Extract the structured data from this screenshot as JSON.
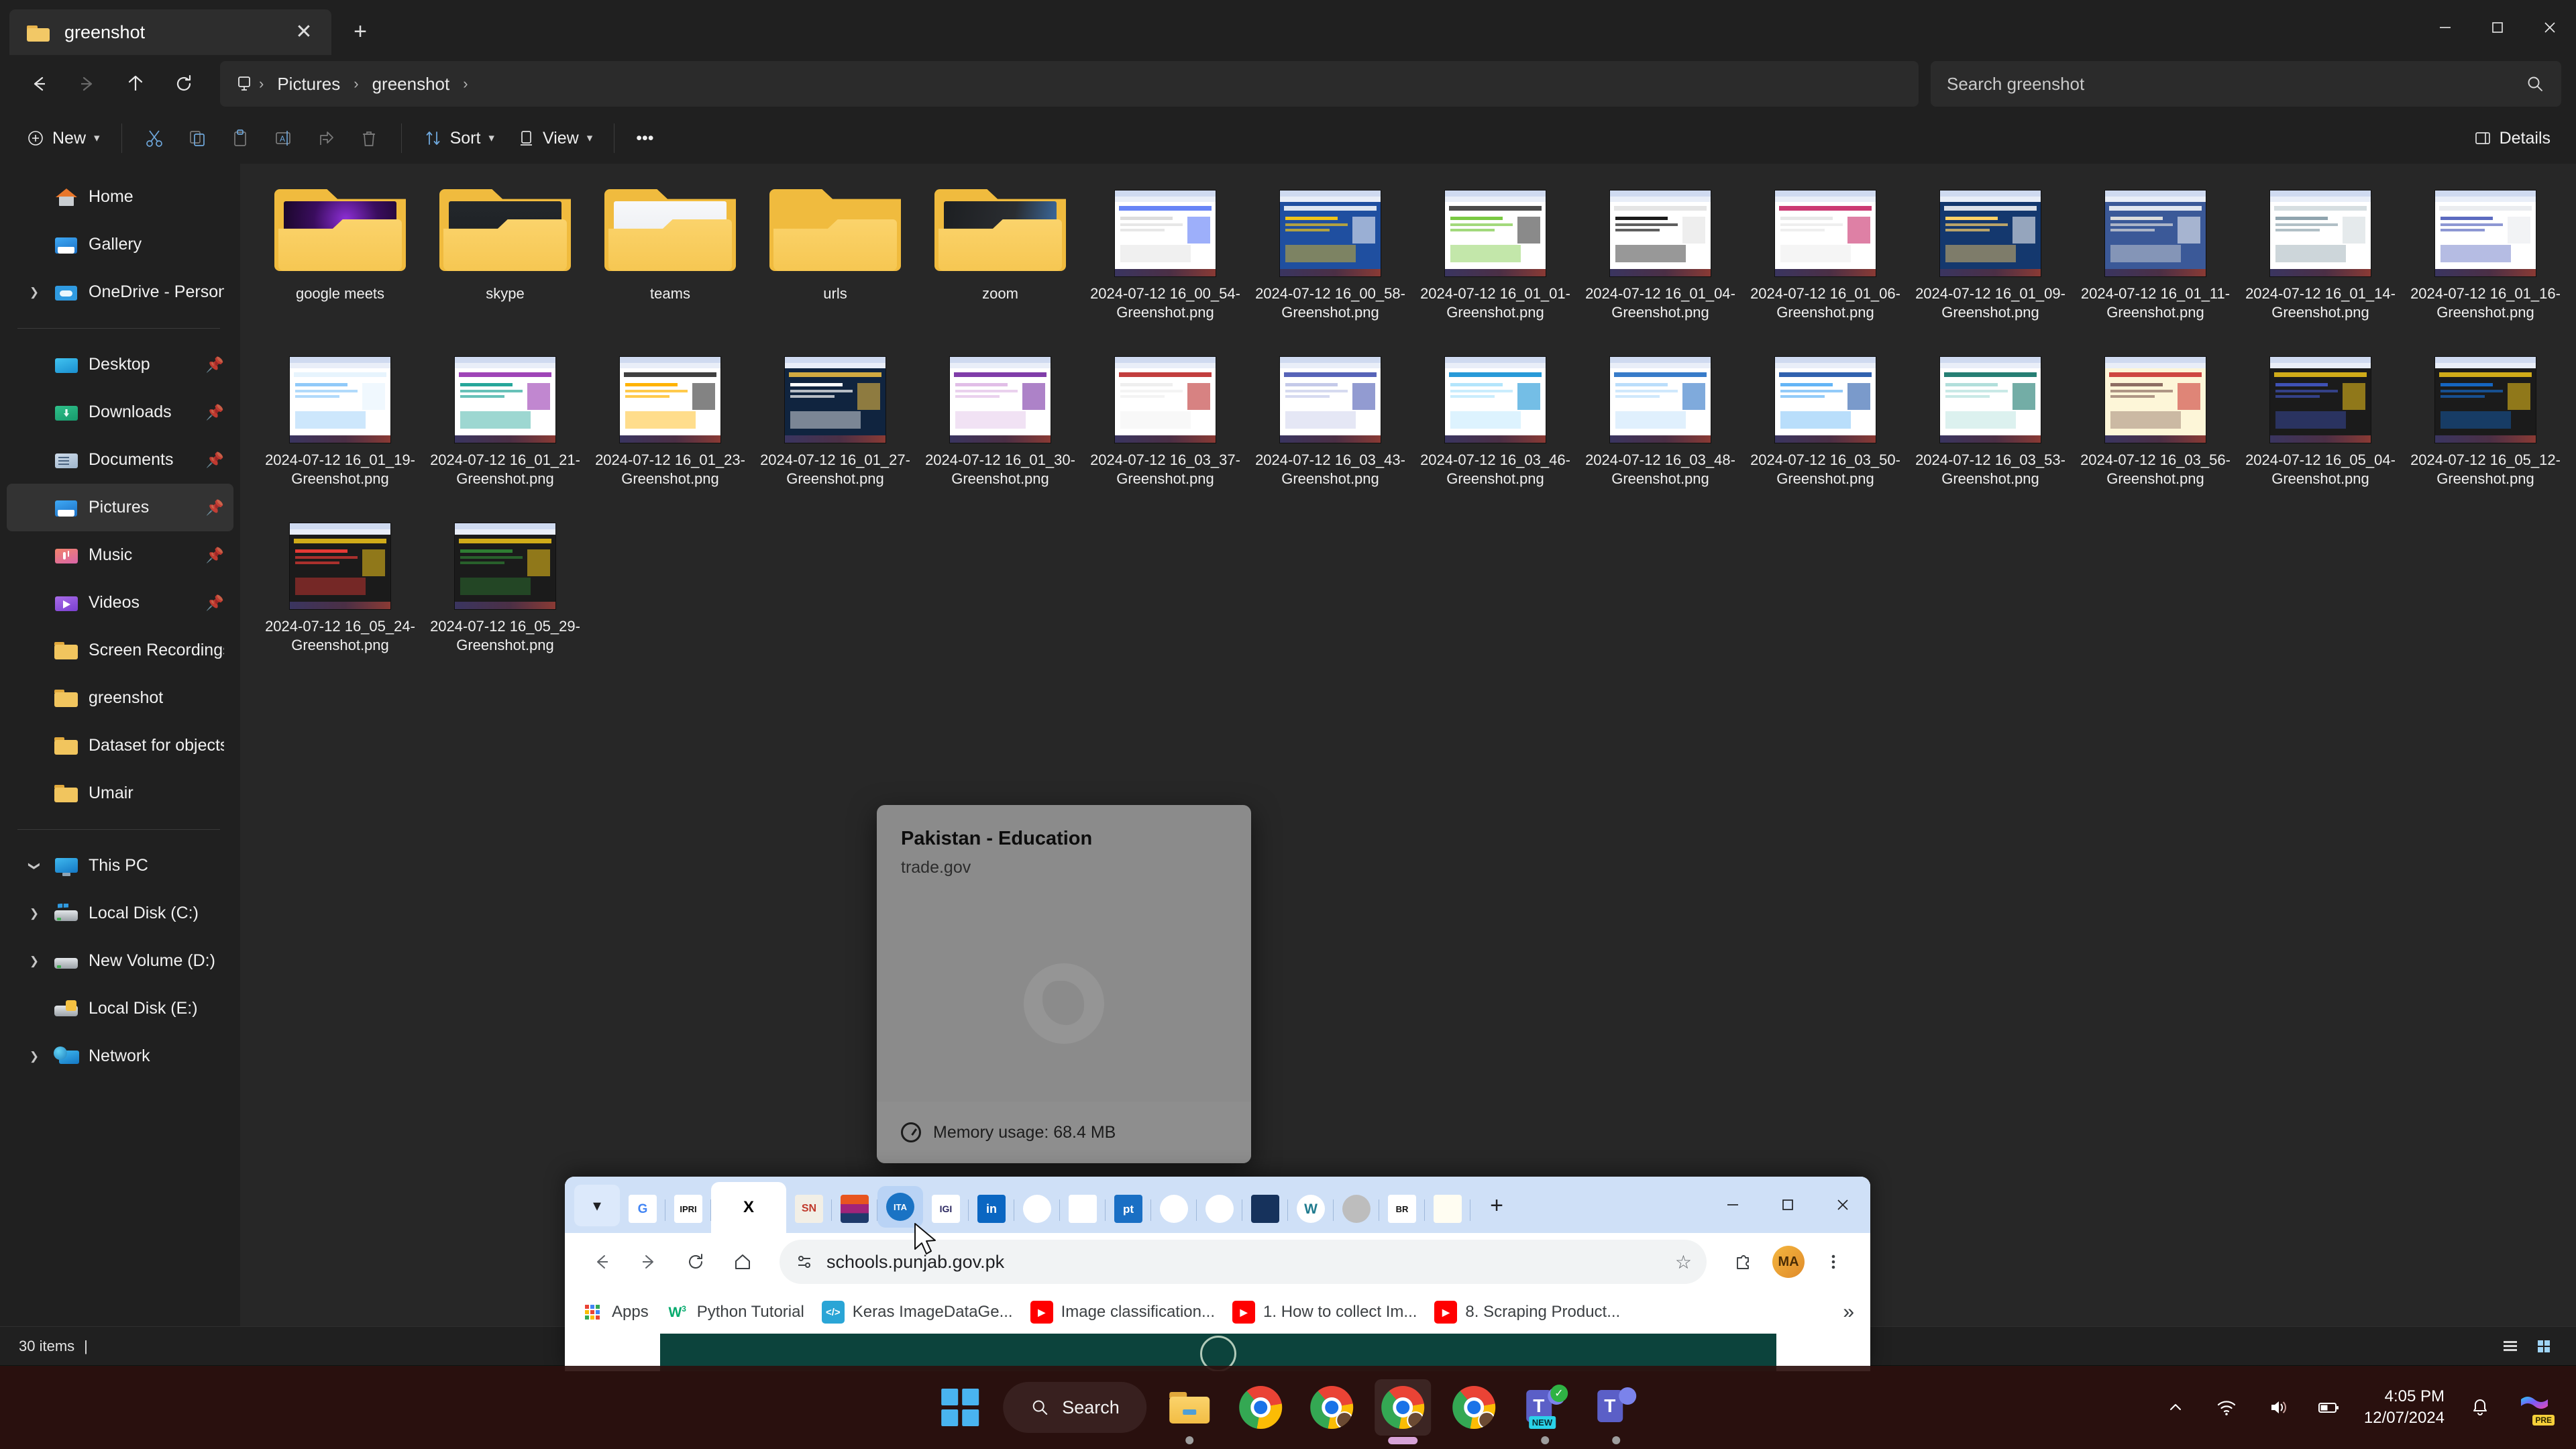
{
  "explorer": {
    "tab": {
      "title": "greenshot",
      "close_label": "✕",
      "new_tab_label": "+"
    },
    "window_controls": {
      "minimize": "—",
      "maximize": "☐",
      "close": "✕"
    },
    "nav": {
      "back": "←",
      "forward": "→",
      "up": "↑",
      "refresh": "↻"
    },
    "breadcrumb": {
      "root_icon": "this-pc-icon",
      "items": [
        "Pictures",
        "greenshot"
      ],
      "separator": "›"
    },
    "search": {
      "placeholder": "Search greenshot",
      "value": "",
      "icon": "search-icon"
    },
    "commandbar": {
      "new_label": "New",
      "cut_label": "Cut",
      "copy_label": "Copy",
      "paste_label": "Paste",
      "rename_label": "Rename",
      "share_label": "Share",
      "delete_label": "Delete",
      "sort_label": "Sort",
      "view_label": "View",
      "more_label": "•••",
      "details_label": "Details"
    },
    "sidebar": {
      "groups": [
        {
          "items": [
            {
              "label": "Home",
              "icon": "home-icon",
              "caret": false,
              "pinned": false,
              "selected": false,
              "indent": false
            },
            {
              "label": "Gallery",
              "icon": "gallery-icon",
              "caret": false,
              "pinned": false,
              "selected": false,
              "indent": false
            },
            {
              "label": "OneDrive - Personal",
              "icon": "onedrive-icon",
              "caret": true,
              "pinned": false,
              "selected": false,
              "indent": false
            }
          ]
        },
        {
          "items": [
            {
              "label": "Desktop",
              "icon": "desktop-icon",
              "caret": false,
              "pinned": true,
              "selected": false,
              "indent": false
            },
            {
              "label": "Downloads",
              "icon": "downloads-icon",
              "caret": false,
              "pinned": true,
              "selected": false,
              "indent": false
            },
            {
              "label": "Documents",
              "icon": "documents-icon",
              "caret": false,
              "pinned": true,
              "selected": false,
              "indent": false
            },
            {
              "label": "Pictures",
              "icon": "pictures-icon",
              "caret": false,
              "pinned": true,
              "selected": true,
              "indent": false
            },
            {
              "label": "Music",
              "icon": "music-icon",
              "caret": false,
              "pinned": true,
              "selected": false,
              "indent": false
            },
            {
              "label": "Videos",
              "icon": "videos-icon",
              "caret": false,
              "pinned": true,
              "selected": false,
              "indent": false
            },
            {
              "label": "Screen Recordings",
              "icon": "folder-icon",
              "caret": false,
              "pinned": false,
              "selected": false,
              "indent": false
            },
            {
              "label": "greenshot",
              "icon": "folder-icon",
              "caret": false,
              "pinned": false,
              "selected": false,
              "indent": false
            },
            {
              "label": "Dataset for objects(",
              "icon": "folder-icon",
              "caret": false,
              "pinned": false,
              "selected": false,
              "indent": false
            },
            {
              "label": "Umair",
              "icon": "folder-icon",
              "caret": false,
              "pinned": false,
              "selected": false,
              "indent": false
            }
          ]
        },
        {
          "items": [
            {
              "label": "This PC",
              "icon": "this-pc-icon",
              "caret": true,
              "caret_open": true,
              "pinned": false,
              "selected": false,
              "indent": false
            },
            {
              "label": "Local Disk (C:)",
              "icon": "windows-disk-icon",
              "caret": true,
              "pinned": false,
              "selected": false,
              "indent": true
            },
            {
              "label": "New Volume (D:)",
              "icon": "disk-icon",
              "caret": true,
              "pinned": false,
              "selected": false,
              "indent": true
            },
            {
              "label": "Local Disk (E:)",
              "icon": "locked-disk-icon",
              "caret": false,
              "pinned": false,
              "selected": false,
              "indent": true
            },
            {
              "label": "Network",
              "icon": "network-icon",
              "caret": true,
              "pinned": false,
              "selected": false,
              "indent": false
            }
          ]
        }
      ]
    },
    "folders": [
      {
        "name": "google meets",
        "preview": "dark-purple"
      },
      {
        "name": "skype",
        "preview": "skype-dark"
      },
      {
        "name": "teams",
        "preview": "teams-light"
      },
      {
        "name": "urls",
        "preview": "none"
      },
      {
        "name": "zoom",
        "preview": "zoom-dark"
      }
    ],
    "files": [
      {
        "name": "2024-07-12 16_00_54-Greenshot.png"
      },
      {
        "name": "2024-07-12 16_00_58-Greenshot.png"
      },
      {
        "name": "2024-07-12 16_01_01-Greenshot.png"
      },
      {
        "name": "2024-07-12 16_01_04-Greenshot.png"
      },
      {
        "name": "2024-07-12 16_01_06-Greenshot.png"
      },
      {
        "name": "2024-07-12 16_01_09-Greenshot.png"
      },
      {
        "name": "2024-07-12 16_01_11-Greenshot.png"
      },
      {
        "name": "2024-07-12 16_01_14-Greenshot.png"
      },
      {
        "name": "2024-07-12 16_01_16-Greenshot.png"
      },
      {
        "name": "2024-07-12 16_01_19-Greenshot.png"
      },
      {
        "name": "2024-07-12 16_01_21-Greenshot.png"
      },
      {
        "name": "2024-07-12 16_01_23-Greenshot.png"
      },
      {
        "name": "2024-07-12 16_01_27-Greenshot.png"
      },
      {
        "name": "2024-07-12 16_01_30-Greenshot.png"
      },
      {
        "name": "2024-07-12 16_03_37-Greenshot.png"
      },
      {
        "name": "2024-07-12 16_03_43-Greenshot.png"
      },
      {
        "name": "2024-07-12 16_03_46-Greenshot.png"
      },
      {
        "name": "2024-07-12 16_03_48-Greenshot.png"
      },
      {
        "name": "2024-07-12 16_03_50-Greenshot.png"
      },
      {
        "name": "2024-07-12 16_03_53-Greenshot.png"
      },
      {
        "name": "2024-07-12 16_03_56-Greenshot.png"
      },
      {
        "name": "2024-07-12 16_05_04-Greenshot.png"
      },
      {
        "name": "2024-07-12 16_05_12-Greenshot.png"
      },
      {
        "name": "2024-07-12 16_05_24-Greenshot.png"
      },
      {
        "name": "2024-07-12 16_05_29-Greenshot.png"
      }
    ],
    "status": {
      "item_count": "30 items",
      "separator": "|"
    }
  },
  "tab_preview": {
    "title": "Pakistan - Education",
    "url": "trade.gov",
    "memory": "Memory usage: 68.4 MB",
    "gauge_icon": "speedometer-icon"
  },
  "chrome": {
    "tabs": [
      {
        "favicon": "google-icon",
        "label": "G",
        "state": "normal"
      },
      {
        "favicon": "ipri-icon",
        "label": "IPRI",
        "state": "normal"
      },
      {
        "favicon": "x-icon",
        "label": "X",
        "state": "active"
      },
      {
        "favicon": "sn-icon",
        "label": "SN",
        "state": "normal"
      },
      {
        "favicon": "stripes-icon",
        "label": "",
        "state": "normal"
      },
      {
        "favicon": "ita-icon",
        "label": "ITA",
        "state": "hover"
      },
      {
        "favicon": "igi-icon",
        "label": "IGI",
        "state": "normal"
      },
      {
        "favicon": "linkedin-icon",
        "label": "in",
        "state": "normal"
      },
      {
        "favicon": "seal-icon",
        "label": "",
        "state": "normal"
      },
      {
        "favicon": "people-icon",
        "label": "",
        "state": "normal"
      },
      {
        "favicon": "pt-icon",
        "label": "pt",
        "state": "normal"
      },
      {
        "favicon": "globe-blue-icon",
        "label": "",
        "state": "normal"
      },
      {
        "favicon": "emblem-icon",
        "label": "",
        "state": "normal"
      },
      {
        "favicon": "wheat-icon",
        "label": "",
        "state": "normal"
      },
      {
        "favicon": "wordpress-icon",
        "label": "W",
        "state": "normal"
      },
      {
        "favicon": "globe-grey-icon",
        "label": "",
        "state": "normal"
      },
      {
        "favicon": "br-icon",
        "label": "BR",
        "state": "normal"
      },
      {
        "favicon": "feather-icon",
        "label": "",
        "state": "normal"
      }
    ],
    "new_tab_label": "+",
    "window_controls": {
      "minimize": "—",
      "maximize": "☐",
      "close": "✕"
    },
    "toolbar": {
      "back": "←",
      "forward": "→",
      "reload": "↻",
      "home": "home-icon",
      "site_settings_icon": "tune-icon",
      "url": "schools.punjab.gov.pk",
      "bookmark_star": "☆",
      "extensions_icon": "puzzle-icon",
      "profile_initials": "MA",
      "menu_icon": "kebab-menu-icon"
    },
    "bookmarks": [
      {
        "label": "Apps",
        "icon": "apps-grid-icon"
      },
      {
        "label": "Python Tutorial",
        "icon": "w3schools-icon"
      },
      {
        "label": "Keras ImageDataGe...",
        "icon": "code-icon"
      },
      {
        "label": "Image classification...",
        "icon": "youtube-icon"
      },
      {
        "label": "1. How to collect Im...",
        "icon": "youtube-icon"
      },
      {
        "label": "8. Scraping Product...",
        "icon": "youtube-icon"
      }
    ],
    "bookmarks_overflow": "»"
  },
  "taskbar": {
    "start_label": "start-button",
    "search_label": "Search",
    "search_icon": "search-icon",
    "items": [
      {
        "name": "file-explorer",
        "icon": "folder-icon",
        "indicator": "dot",
        "active": false
      },
      {
        "name": "chrome-1",
        "icon": "chrome-icon",
        "indicator": "none",
        "active": false
      },
      {
        "name": "chrome-2",
        "icon": "chrome-profile-icon",
        "indicator": "none",
        "active": false
      },
      {
        "name": "chrome-3",
        "icon": "chrome-profile-icon",
        "indicator": "bar",
        "active": true
      },
      {
        "name": "chrome-4",
        "icon": "chrome-profile-icon",
        "indicator": "none",
        "active": false
      },
      {
        "name": "teams-new",
        "icon": "teams-icon",
        "indicator": "dot",
        "active": false
      },
      {
        "name": "teams",
        "icon": "teams-icon",
        "indicator": "dot",
        "active": false
      }
    ],
    "tray": {
      "overflow": "∧",
      "wifi_icon": "wifi-icon",
      "volume_icon": "volume-icon",
      "battery_icon": "battery-icon",
      "time": "4:05 PM",
      "date": "12/07/2024",
      "notifications_icon": "bell-icon",
      "copilot_icon": "copilot-icon",
      "copilot_badge": "PRE"
    }
  }
}
